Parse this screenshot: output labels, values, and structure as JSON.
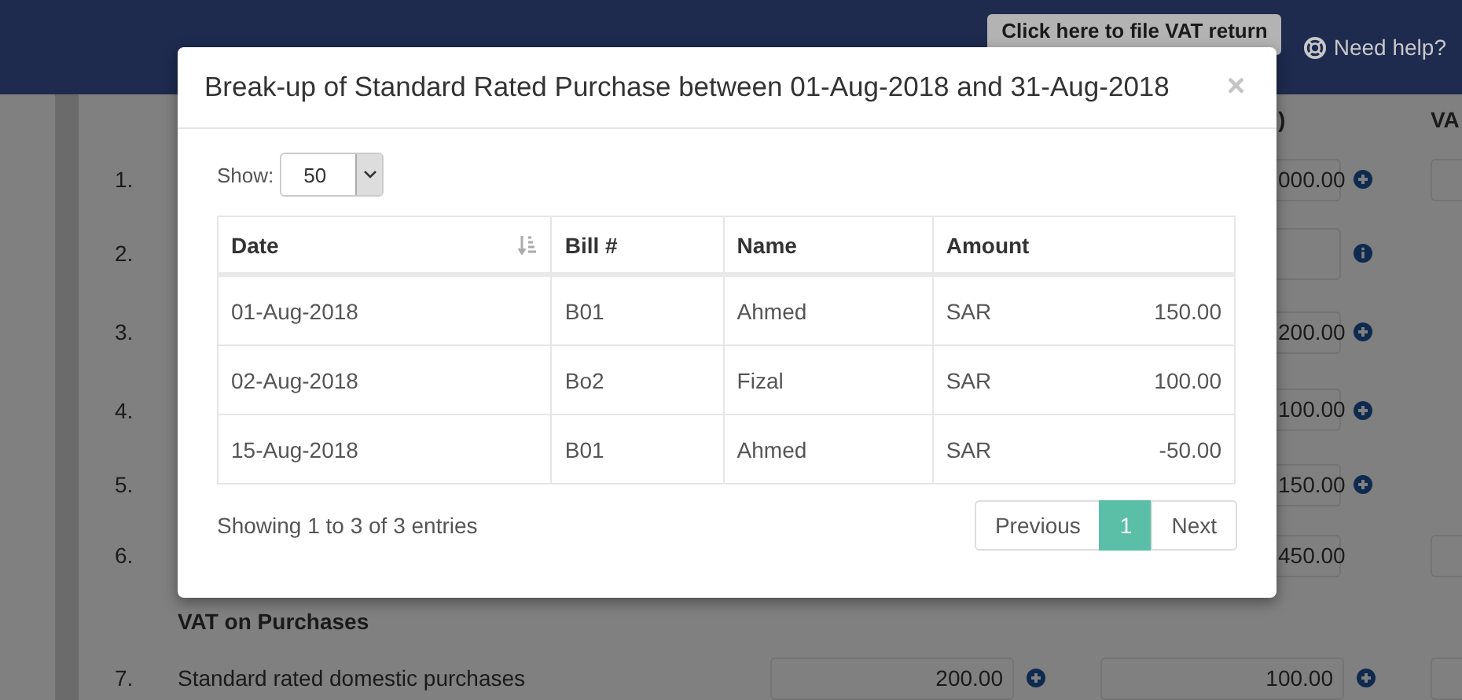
{
  "header": {
    "file_button": "Click here to file VAT return",
    "help_link": "Need help?"
  },
  "background_form": {
    "column_headers": [
      ")",
      "VA"
    ],
    "rows": [
      {
        "number": "1.",
        "kind": "amount",
        "value": "000.00",
        "col3_field": true
      },
      {
        "number": "2.",
        "kind": "info",
        "col3_field": false
      },
      {
        "number": "3.",
        "kind": "amount",
        "value": "200.00",
        "col3_field": false
      },
      {
        "number": "4.",
        "kind": "amount",
        "value": "100.00",
        "col3_field": false
      },
      {
        "number": "5.",
        "kind": "amount",
        "value": "150.00",
        "col3_field": false
      },
      {
        "number": "6.",
        "kind": "total",
        "value": "450.00",
        "col3_field": true
      }
    ],
    "section_title": "VAT on Purchases",
    "row_7": {
      "number": "7.",
      "label": "Standard rated domestic purchases",
      "amount": "200.00",
      "vat": "100.00",
      "col3_field": true
    }
  },
  "modal": {
    "title": "Break-up of Standard Rated Purchase between 01-Aug-2018 and 31-Aug-2018",
    "close": "×",
    "show_label": "Show:",
    "page_size": "50",
    "table": {
      "columns": [
        {
          "label": "Date",
          "sorted": true
        },
        {
          "label": "Bill #",
          "sorted": false
        },
        {
          "label": "Name",
          "sorted": false
        },
        {
          "label": "Amount",
          "sorted": false
        }
      ],
      "rows": [
        {
          "date": "01-Aug-2018",
          "bill": "B01",
          "name": "Ahmed",
          "currency": "SAR",
          "amount": "150.00"
        },
        {
          "date": "02-Aug-2018",
          "bill": "Bo2",
          "name": "Fizal",
          "currency": "SAR",
          "amount": "100.00"
        },
        {
          "date": "15-Aug-2018",
          "bill": "B01",
          "name": "Ahmed",
          "currency": "SAR",
          "amount": "-50.00"
        }
      ]
    },
    "info": "Showing 1 to 3 of 3 entries",
    "pagination": [
      {
        "label": "Previous",
        "selected": false
      },
      {
        "label": "1",
        "selected": true
      },
      {
        "label": "Next",
        "selected": false
      }
    ]
  }
}
